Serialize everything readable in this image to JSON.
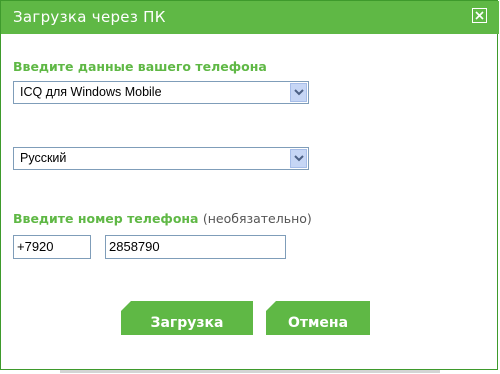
{
  "window": {
    "title": "Загрузка через ПК"
  },
  "phone_section": {
    "label": "Введите данные вашего телефона",
    "device_select": {
      "value": "ICQ для Windows Mobile"
    },
    "language_select": {
      "value": "Русский"
    }
  },
  "number_section": {
    "label": "Введите номер телефона",
    "optional_note": "(необязательно)",
    "code_input": {
      "value": "+7920"
    },
    "number_input": {
      "value": "2858790"
    }
  },
  "buttons": {
    "download_label": "Загрузка",
    "cancel_label": "Отмена"
  },
  "colors": {
    "accent": "#5fb845",
    "border": "#3e9a2c"
  },
  "icons": {
    "close": "close-icon",
    "dropdown": "chevron-down-icon"
  }
}
